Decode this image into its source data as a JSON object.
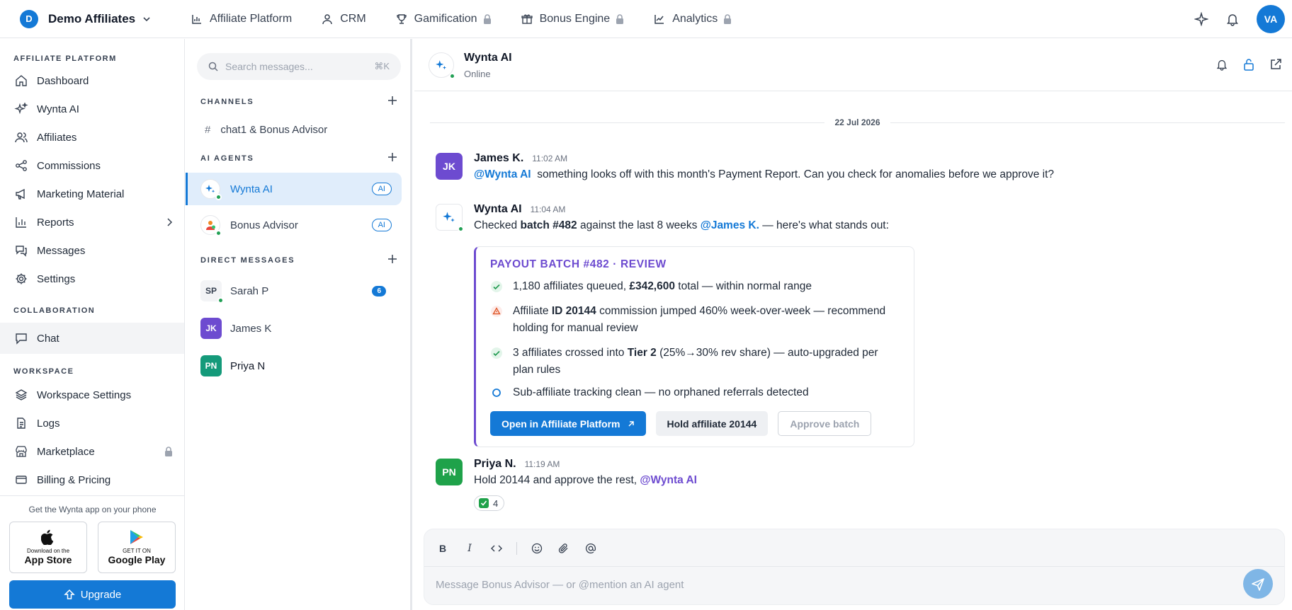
{
  "topbar": {
    "brand_initial": "D",
    "brand_name": "Demo Affiliates",
    "nav": [
      {
        "label": "Affiliate Platform",
        "icon": "bar-chart-icon",
        "locked": false
      },
      {
        "label": "CRM",
        "icon": "user-icon",
        "locked": false
      },
      {
        "label": "Gamification",
        "icon": "trophy-icon",
        "locked": true
      },
      {
        "label": "Bonus Engine",
        "icon": "gift-icon",
        "locked": true
      },
      {
        "label": "Analytics",
        "icon": "line-chart-icon",
        "locked": true
      }
    ],
    "user_initials": "VA"
  },
  "sidebar": {
    "sections": {
      "affiliate_platform": "AFFILIATE PLATFORM",
      "collaboration": "COLLABORATION",
      "workspace": "WORKSPACE"
    },
    "items": {
      "dashboard": "Dashboard",
      "wynta_ai": "Wynta AI",
      "affiliates": "Affiliates",
      "commissions": "Commissions",
      "marketing_material": "Marketing Material",
      "reports": "Reports",
      "messages": "Messages",
      "settings": "Settings",
      "chat": "Chat",
      "workspace_settings": "Workspace Settings",
      "logs": "Logs",
      "marketplace": "Marketplace",
      "billing": "Billing & Pricing"
    },
    "promo": {
      "text": "Get the Wynta app on your phone",
      "appstore_small": "Download on the",
      "appstore_big": "App Store",
      "googleplay_small": "GET IT ON",
      "googleplay_big": "Google Play"
    },
    "upgrade_label": "Upgrade"
  },
  "channels": {
    "search_placeholder": "Search messages...",
    "search_shortcut": "⌘K",
    "sections": {
      "channels": "CHANNELS",
      "ai_agents": "AI AGENTS",
      "direct_messages": "DIRECT MESSAGES"
    },
    "channel_list": [
      {
        "name": "chat1 & Bonus Advisor"
      }
    ],
    "agents": [
      {
        "name": "Wynta AI",
        "badge": "AI"
      },
      {
        "name": "Bonus Advisor",
        "badge": "AI"
      }
    ],
    "dms": [
      {
        "initials": "SP",
        "name": "Sarah P",
        "unread": "6",
        "bg": "#f3f4f6",
        "fg": "#374151"
      },
      {
        "initials": "JK",
        "name": "James K",
        "bg": "#6d4bd0",
        "fg": "#ffffff"
      },
      {
        "initials": "PN",
        "name": "Priya N",
        "bg": "#149a7a",
        "fg": "#ffffff"
      }
    ]
  },
  "chat": {
    "title": "Wynta AI",
    "status": "Online",
    "date": "22 Jul 2026",
    "messages": [
      {
        "author": "James K.",
        "initials": "JK",
        "time": "11:02 AM",
        "mention": "@Wynta AI",
        "text": "something looks off with this month's Payment Report. Can you check for anomalies before we approve it?"
      },
      {
        "author": "Wynta AI",
        "time": "11:04 AM",
        "text_a": "Checked",
        "text_b": "batch #482",
        "text_c": "against the last 8 weeks",
        "mention": "@James K.",
        "text_d": "— here's what stands out:"
      },
      {
        "author": "Priya N.",
        "initials": "PN",
        "time": "11:19 AM",
        "text": "Hold 20144 and approve the rest,",
        "mention": "@Wynta AI",
        "reaction_count": "4"
      }
    ],
    "card": {
      "title": "PAYOUT BATCH #482 · REVIEW",
      "row1": {
        "a": "1,180 affiliates queued,",
        "b": "£342,600",
        "c": "total — within normal range"
      },
      "row2": {
        "a": "Affiliate",
        "b": "ID 20144",
        "c": "commission jumped 460% week-over-week — recommend holding for manual review"
      },
      "row3": {
        "a": "3 affiliates crossed into",
        "b": "Tier 2",
        "c": "(25%→30% rev share) — auto-upgraded per plan rules"
      },
      "row4": {
        "a": "Sub-affiliate tracking clean — no orphaned referrals detected"
      },
      "actions": {
        "open": "Open in Affiliate Platform",
        "hold": "Hold affiliate 20144",
        "approve": "Approve batch"
      }
    },
    "composer_placeholder": "Message Bonus Advisor — or @mention an AI agent"
  },
  "colors": {
    "accent": "#1479d6",
    "agent_purple": "#6d4bd0",
    "online": "#22a055"
  }
}
